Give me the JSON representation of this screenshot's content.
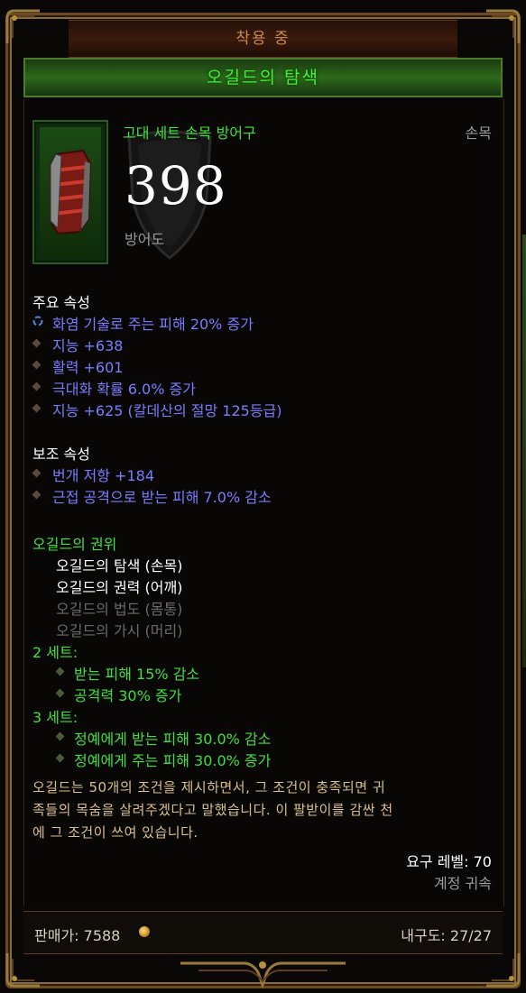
{
  "header": {
    "equipped_label": "착용 중",
    "item_name": "오길드의 탐색"
  },
  "item": {
    "type": "고대 세트 손목 방어구",
    "slot": "손목",
    "armor_value": "398",
    "armor_label": "방어도"
  },
  "primary": {
    "title": "주요 속성",
    "props": [
      "화염 기술로 주는 피해 20% 증가",
      "지능 +638",
      "활력 +601",
      "극대화 확률 6.0% 증가",
      "지능 +625 (칼데산의 절망 125등급)"
    ]
  },
  "secondary": {
    "title": "보조 속성",
    "props": [
      "번개 저항 +184",
      "근접 공격으로 받는 피해 7.0% 감소"
    ]
  },
  "set": {
    "title": "오길드의 권위",
    "items": [
      {
        "label": "오길드의 탐색 (손목)",
        "owned": true
      },
      {
        "label": "오길드의 권력 (어깨)",
        "owned": true
      },
      {
        "label": "오길드의 법도 (몸통)",
        "owned": false
      },
      {
        "label": "오길드의 가시 (머리)",
        "owned": false
      }
    ],
    "bonuses": [
      {
        "label": "2 세트:",
        "effects": [
          "받는 피해 15% 감소",
          "공격력 30% 증가"
        ]
      },
      {
        "label": "3 세트:",
        "effects": [
          "정예에게 받는 피해 30.0% 감소",
          "정예에게 주는 피해 30.0% 증가"
        ]
      }
    ]
  },
  "flavor": [
    "오길드는 50개의 조건을 제시하면서, 그 조건이 충족되면 귀",
    "족들의 목숨을 살려주겠다고 말했습니다. 이 팔받이를 감싼 천",
    "에 그 조건이 쓰여 있습니다."
  ],
  "requirements": {
    "level": "요구 레벨: 70",
    "bound": "계정 귀속"
  },
  "footer": {
    "price": "판매가: 7588",
    "durability": "내구도: 27/27"
  },
  "colors": {
    "set_green": "#3fe03a",
    "magic_blue": "#7b7bff",
    "unowned_gray": "#6a6a6a",
    "flavor_tan": "#d8c08a"
  }
}
